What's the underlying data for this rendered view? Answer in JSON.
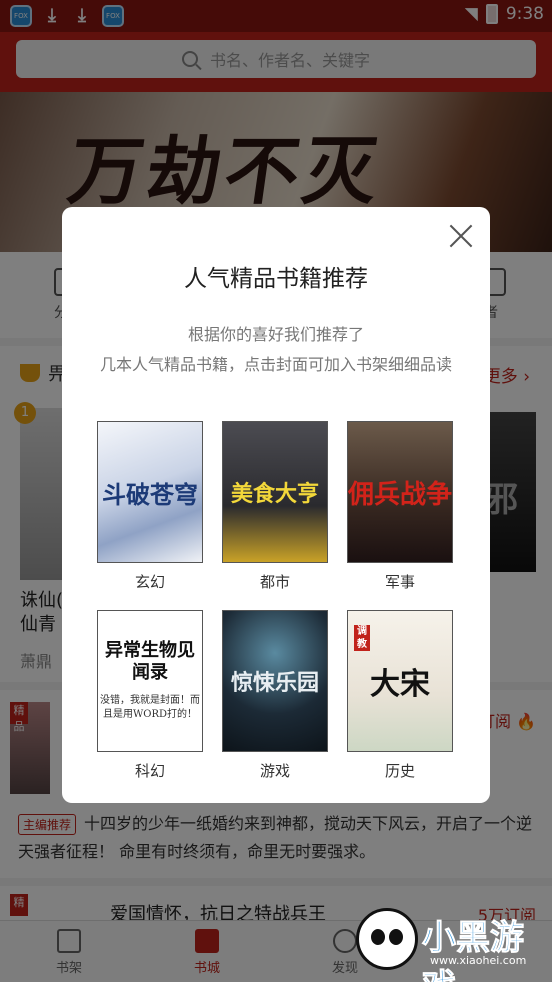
{
  "status_bar": {
    "time": "9:38"
  },
  "header": {
    "search_placeholder": "书名、作者名、关键字"
  },
  "banner": {
    "title": "万劫不灭"
  },
  "background": {
    "category_left": "分",
    "category_right": "者",
    "section_title_fragment": "畀",
    "more": "更多",
    "rank_badge": "1",
    "book_title_line1": "诛仙(",
    "book_title_line2": "仙青",
    "book_author": "萧鼎",
    "book_right_text": "邪",
    "card_tag": "精品",
    "card_subscribe": "订阅",
    "editor_tag": "主编推荐",
    "card_desc": "十四岁的少年一纸婚约来到神都，搅动天下风云，开启了一个逆天强者征程！ 命里有时终须有，命里无时要强求。",
    "card2_tag": "精",
    "card2_title": "爱国情怀，抗日之特战兵王",
    "card2_subscribe": "5万订阅"
  },
  "bottom_nav": {
    "items": [
      {
        "label": "书架"
      },
      {
        "label": "书城"
      },
      {
        "label": "发现"
      }
    ]
  },
  "modal": {
    "title": "人气精品书籍推荐",
    "desc_line1": "根据你的喜好我们推荐了",
    "desc_line2": "几本人气精品书籍，点击封面可加入书架细细品读",
    "books": [
      {
        "genre": "玄幻",
        "cover_text": "斗破苍穹"
      },
      {
        "genre": "都市",
        "cover_text": "美食大亨"
      },
      {
        "genre": "军事",
        "cover_text": "佣兵战争"
      },
      {
        "genre": "科幻",
        "cover_text": "异常生物见闻录",
        "cover_sub": "没错，我就是封面！而且是用WORD打的！"
      },
      {
        "genre": "游戏",
        "cover_text": "惊悚乐园"
      },
      {
        "genre": "历史",
        "cover_text": "大宋",
        "cover_tag": "调教"
      }
    ]
  },
  "watermark": {
    "brand": "小黑游戏",
    "url": "www.xiaohei.com"
  }
}
